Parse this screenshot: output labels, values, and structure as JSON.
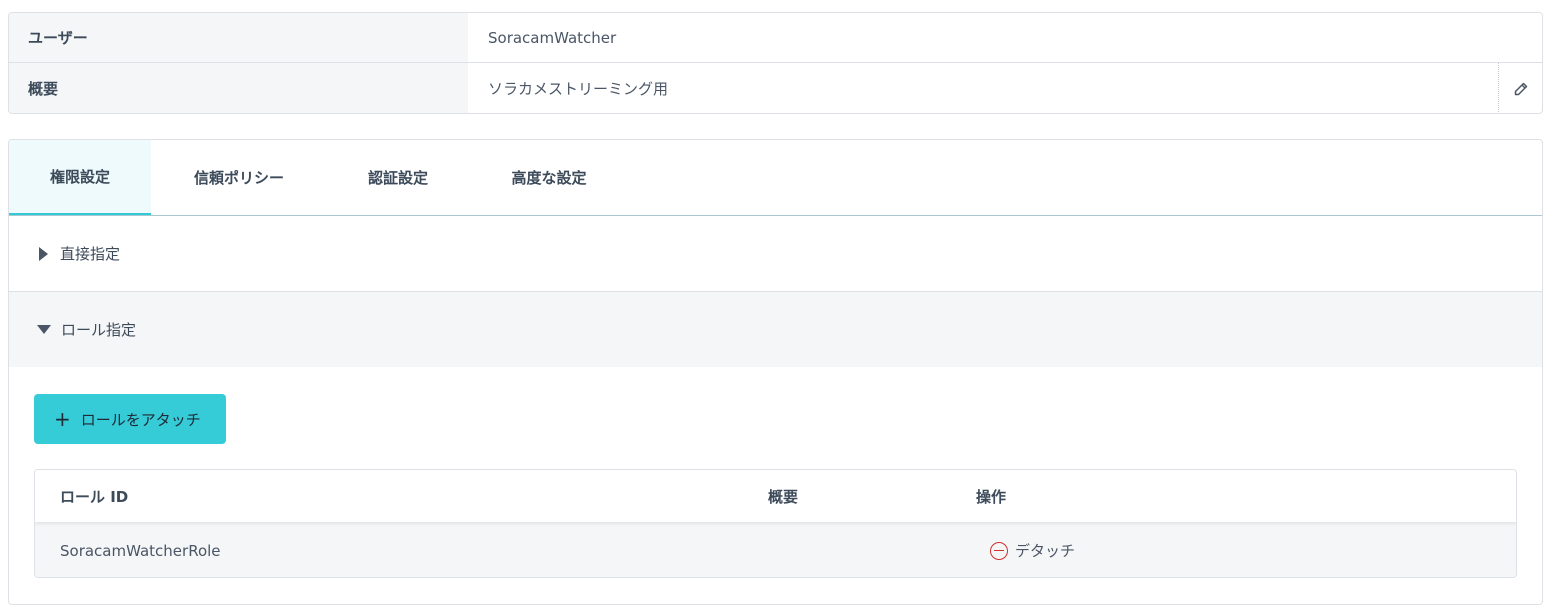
{
  "user_info": {
    "user_label": "ユーザー",
    "user_value": "SoracamWatcher",
    "description_label": "概要",
    "description_value": "ソラカメストリーミング用",
    "edit_icon": "pencil-icon"
  },
  "tabs": [
    {
      "label": "権限設定",
      "active": true
    },
    {
      "label": "信頼ポリシー",
      "active": false
    },
    {
      "label": "認証設定",
      "active": false
    },
    {
      "label": "高度な設定",
      "active": false
    }
  ],
  "accordion": {
    "direct_label": "直接指定",
    "role_label": "ロール指定"
  },
  "attach_button": {
    "icon": "plus-icon",
    "label": "ロールをアタッチ"
  },
  "role_table": {
    "columns": [
      "ロール ID",
      "概要",
      "操作"
    ],
    "rows": [
      {
        "role_id": "SoracamWatcherRole",
        "description": "",
        "action_label": "デタッチ"
      }
    ]
  },
  "colors": {
    "accent": "#35cbd7",
    "danger": "#d0342c"
  }
}
